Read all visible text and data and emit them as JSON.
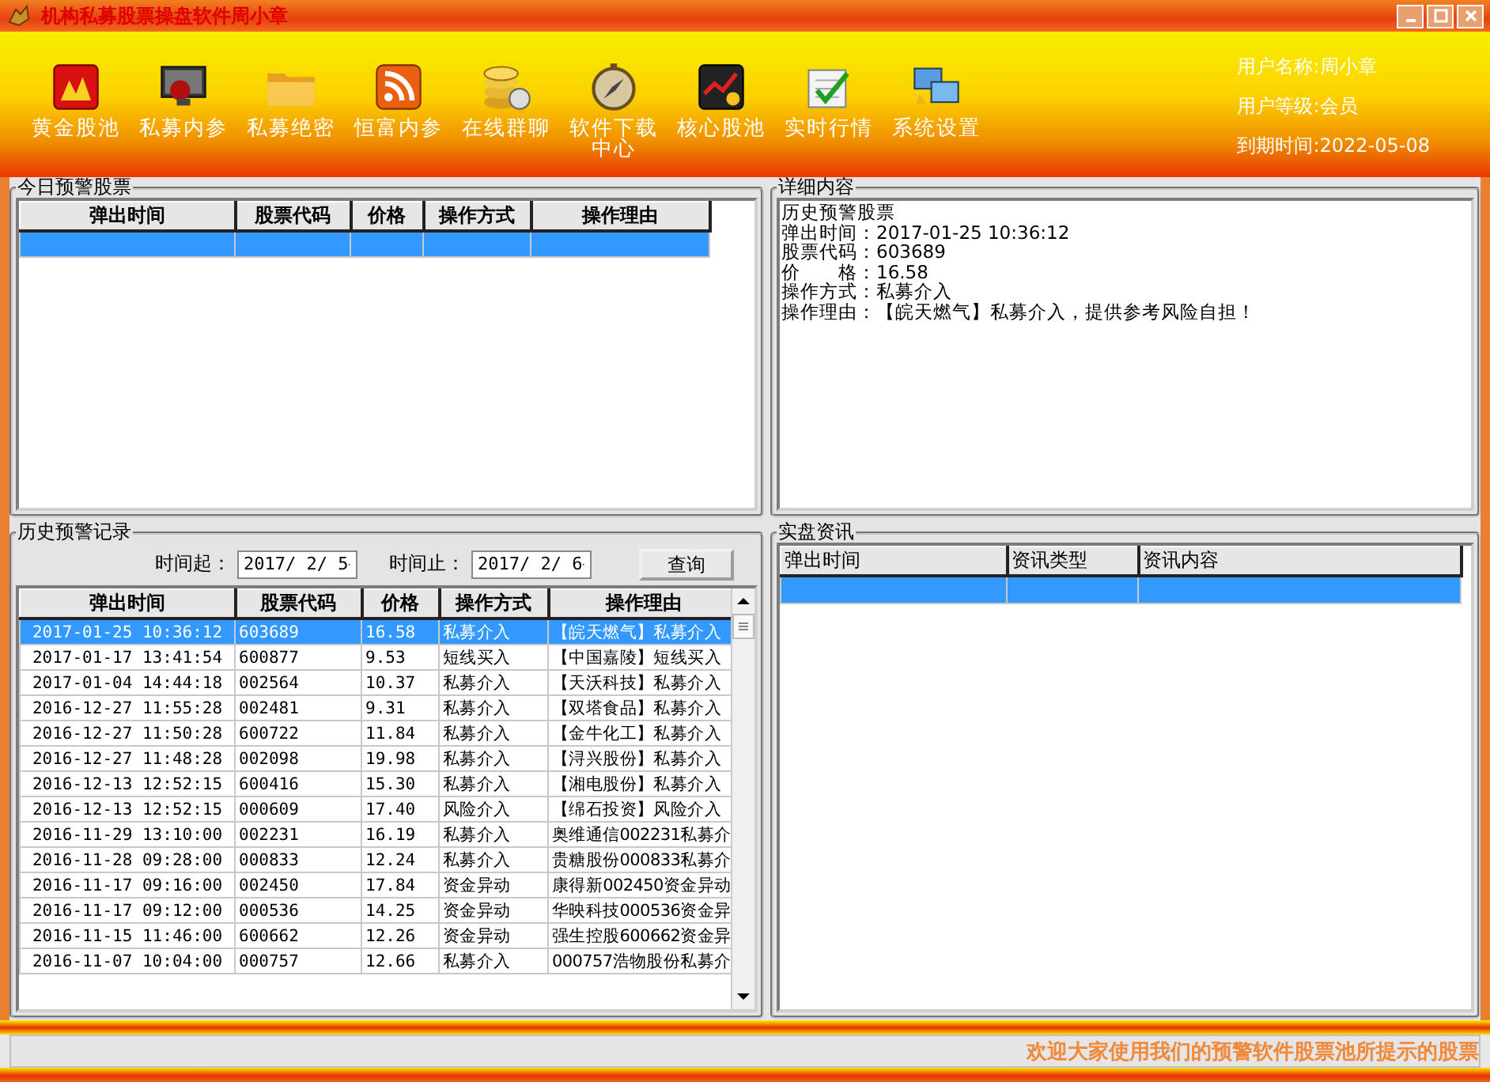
{
  "window": {
    "title": "机构私募股票操盘软件周小章"
  },
  "toolbar": [
    {
      "label": "黄金股池"
    },
    {
      "label": "私募内参"
    },
    {
      "label": "私募绝密"
    },
    {
      "label": "恒富内参"
    },
    {
      "label": "在线群聊"
    },
    {
      "label": "软件下载中心"
    },
    {
      "label": "核心股池"
    },
    {
      "label": "实时行情"
    },
    {
      "label": "系统设置"
    }
  ],
  "user_info": [
    {
      "label": "用户名称:",
      "value": "周小章"
    },
    {
      "label": "用户等级:",
      "value": "会员"
    },
    {
      "label": "到期时间:",
      "value": "2022-05-08"
    }
  ],
  "today_alerts": {
    "title": "今日预警股票",
    "columns": [
      "弹出时间",
      "股票代码",
      "价格",
      "操作方式",
      "操作理由"
    ],
    "rows": [
      {
        "selected": true
      }
    ]
  },
  "details": {
    "title": "详细内容",
    "lines": [
      "历史预警股票",
      "弹出时间：2017-01-25 10:36:12",
      "股票代码：603689",
      "价　　格：16.58",
      "操作方式：私募介入",
      "操作理由：【皖天燃气】私募介入，提供参考风险自担！"
    ]
  },
  "history": {
    "title": "历史预警记录",
    "from_label": "时间起：",
    "from_value": "2017/ 2/ 5",
    "to_label": "时间止：",
    "to_value": "2017/ 2/ 6",
    "query_button": "查询",
    "columns": [
      "弹出时间",
      "股票代码",
      "价格",
      "操作方式",
      "操作理由"
    ],
    "rows": [
      {
        "selected": true,
        "cells": [
          "2017-01-25 10:36:12",
          "603689",
          "16.58",
          "私募介入",
          "【皖天燃气】私募介入"
        ]
      },
      {
        "selected": false,
        "cells": [
          "2017-01-17 13:41:54",
          "600877",
          "9.53",
          "短线买入",
          "【中国嘉陵】短线买入"
        ]
      },
      {
        "selected": false,
        "cells": [
          "2017-01-04 14:44:18",
          "002564",
          "10.37",
          "私募介入",
          "【天沃科技】私募介入"
        ]
      },
      {
        "selected": false,
        "cells": [
          "2016-12-27 11:55:28",
          "002481",
          "9.31",
          "私募介入",
          "【双塔食品】私募介入"
        ]
      },
      {
        "selected": false,
        "cells": [
          "2016-12-27 11:50:28",
          "600722",
          "11.84",
          "私募介入",
          "【金牛化工】私募介入"
        ]
      },
      {
        "selected": false,
        "cells": [
          "2016-12-27 11:48:28",
          "002098",
          "19.98",
          "私募介入",
          "【浔兴股份】私募介入"
        ]
      },
      {
        "selected": false,
        "cells": [
          "2016-12-13 12:52:15",
          "600416",
          "15.30",
          "私募介入",
          "【湘电股份】私募介入"
        ]
      },
      {
        "selected": false,
        "cells": [
          "2016-12-13 12:52:15",
          "000609",
          "17.40",
          "风险介入",
          "【绵石投资】风险介入"
        ]
      },
      {
        "selected": false,
        "cells": [
          "2016-11-29 13:10:00",
          "002231",
          "16.19",
          "私募介入",
          "奥维通信002231私募介"
        ]
      },
      {
        "selected": false,
        "cells": [
          "2016-11-28 09:28:00",
          "000833",
          "12.24",
          "私募介入",
          "贵糖股份000833私募介"
        ]
      },
      {
        "selected": false,
        "cells": [
          "2016-11-17 09:16:00",
          "002450",
          "17.84",
          "资金异动",
          "康得新002450资金异动"
        ]
      },
      {
        "selected": false,
        "cells": [
          "2016-11-17 09:12:00",
          "000536",
          "14.25",
          "资金异动",
          "华映科技000536资金异"
        ]
      },
      {
        "selected": false,
        "cells": [
          "2016-11-15 11:46:00",
          "600662",
          "12.26",
          "资金异动",
          "强生控股600662资金异"
        ]
      },
      {
        "selected": false,
        "cells": [
          "2016-11-07 10:04:00",
          "000757",
          "12.66",
          "私募介入",
          "000757浩物股份私募介"
        ]
      }
    ]
  },
  "live_news": {
    "title": "实盘资讯",
    "columns": [
      "弹出时间",
      "资讯类型",
      "资讯内容"
    ],
    "rows": [
      {
        "selected": true
      }
    ]
  },
  "status_bar": {
    "marquee": "欢迎大家使用我们的预警软件股票池所提示的股票"
  }
}
